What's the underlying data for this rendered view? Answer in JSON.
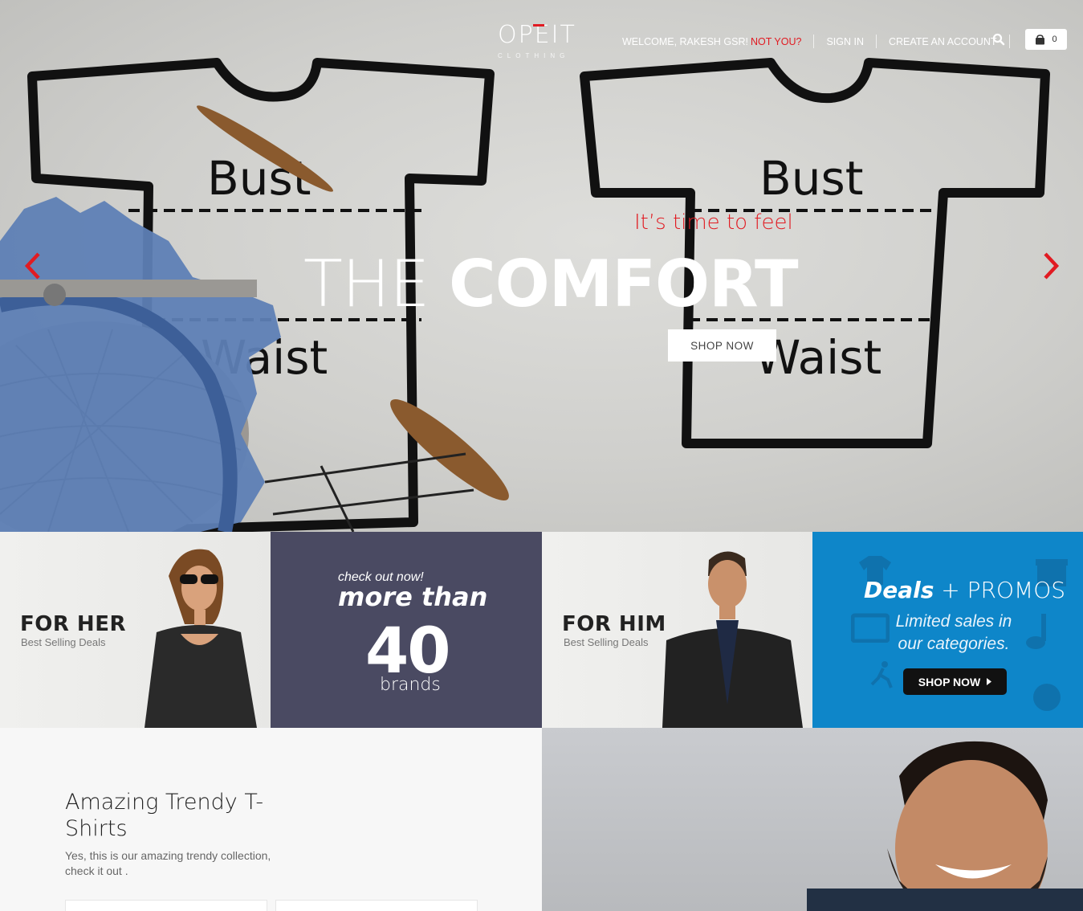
{
  "header": {
    "logo_text": "OPEIT",
    "logo_sub": "CLOTHING",
    "welcome": "WELCOME, RAKESH GSR!",
    "not_you": "NOT YOU?",
    "sign_in": "SIGN IN",
    "create_account": "CREATE AN ACCOUNT",
    "cart_count": "0"
  },
  "hero": {
    "tagline": "It’s time to feel",
    "headline_light": "THE ",
    "headline_bold": "COMFORT",
    "cta": "SHOP NOW",
    "sketch_labels": {
      "bust": "Bust",
      "waist": "Waist"
    }
  },
  "promos": {
    "her": {
      "title": "FOR HER",
      "subtitle": "Best Selling Deals"
    },
    "brands": {
      "kicker": "check out now!",
      "more": "more than",
      "number": "40",
      "unit": "brands"
    },
    "him": {
      "title": "FOR HIM",
      "subtitle": "Best Selling Deals"
    },
    "deals": {
      "deals": "Deals",
      "plus": " + PROMOS",
      "text": "Limited sales in our categories.",
      "cta": "SHOP NOW"
    }
  },
  "section": {
    "title": "Amazing Trendy T-Shirts",
    "text": "Yes, this is our amazing trendy collection, check it out ."
  },
  "colors": {
    "accent": "#e11b22",
    "brands_bg": "#4a4a62",
    "deals_bg": "#0e86c9"
  }
}
